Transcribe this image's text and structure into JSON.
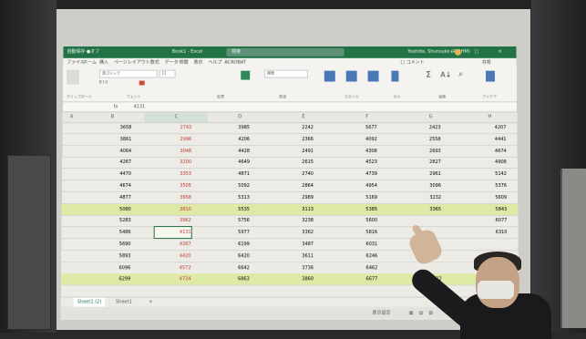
{
  "window": {
    "autosave": "自動保存 ●オフ",
    "filename": "Book1 - Excel",
    "search_placeholder": "検索",
    "user": "Yoshida, Shunsuke (ICOHM)",
    "controls": "— □ ✕"
  },
  "menu": {
    "items": [
      "ファイル",
      "ホーム",
      "挿入",
      "ページレイアウト",
      "数式",
      "データ",
      "校閲",
      "表示",
      "ヘルプ",
      "ACROBAT"
    ],
    "comments": "□ コメント",
    "share": "共有"
  },
  "ribbon": {
    "font_name": "游ゴシック",
    "font_size": "11",
    "number_format": "標準",
    "groups": [
      "クリップボード",
      "フォント",
      "配置",
      "数値",
      "スタイル",
      "セル",
      "編集",
      "アイデア"
    ]
  },
  "formula_bar": {
    "fx": "fx",
    "value": "4131"
  },
  "columns": [
    "A",
    "B",
    "C",
    "D",
    "E",
    "F",
    "G",
    "H"
  ],
  "rows": [
    {
      "b": "3658",
      "c": "2743",
      "d": "3985",
      "e": "2242",
      "f": "5677",
      "g": "2423",
      "h": "4207",
      "hl": false
    },
    {
      "b": "3861",
      "c": "2996",
      "d": "4206",
      "e": "2366",
      "f": "4092",
      "g": "2558",
      "h": "4441",
      "hl": false
    },
    {
      "b": "4064",
      "c": "3048",
      "d": "4428",
      "e": "2491",
      "f": "4308",
      "g": "2693",
      "h": "4674",
      "hl": false
    },
    {
      "b": "4267",
      "c": "3200",
      "d": "4649",
      "e": "2615",
      "f": "4523",
      "g": "2827",
      "h": "4908",
      "hl": false
    },
    {
      "b": "4470",
      "c": "3353",
      "d": "4871",
      "e": "2740",
      "f": "4739",
      "g": "2961",
      "h": "5142",
      "hl": false
    },
    {
      "b": "4674",
      "c": "3505",
      "d": "5092",
      "e": "2864",
      "f": "4954",
      "g": "3096",
      "h": "5376",
      "hl": false
    },
    {
      "b": "4877",
      "c": "3658",
      "d": "5313",
      "e": "2989",
      "f": "5169",
      "g": "3232",
      "h": "5609",
      "hl": false
    },
    {
      "b": "5080",
      "c": "3810",
      "d": "5535",
      "e": "3113",
      "f": "5385",
      "g": "3365",
      "h": "5843",
      "hl": true
    },
    {
      "b": "5283",
      "c": "3962",
      "d": "5756",
      "e": "3238",
      "f": "5600",
      "g": "",
      "h": "6077",
      "hl": false
    },
    {
      "b": "5486",
      "c": "4131",
      "d": "5977",
      "e": "3362",
      "f": "5816",
      "g": "",
      "h": "6310",
      "hl": false
    },
    {
      "b": "5690",
      "c": "4267",
      "d": "6199",
      "e": "3487",
      "f": "6031",
      "g": "",
      "h": "",
      "hl": false
    },
    {
      "b": "5893",
      "c": "4420",
      "d": "6420",
      "e": "3611",
      "f": "6246",
      "g": "",
      "h": "",
      "hl": false
    },
    {
      "b": "6096",
      "c": "4572",
      "d": "6642",
      "e": "3736",
      "f": "6462",
      "g": "",
      "h": "",
      "hl": false
    },
    {
      "b": "6299",
      "c": "4724",
      "d": "6863",
      "e": "3860",
      "f": "6677",
      "g": "4122",
      "h": "",
      "hl": true
    }
  ],
  "sheets": [
    "Sheet1 (2)",
    "Sheet1",
    "+"
  ],
  "status": {
    "display": "表示設定"
  }
}
